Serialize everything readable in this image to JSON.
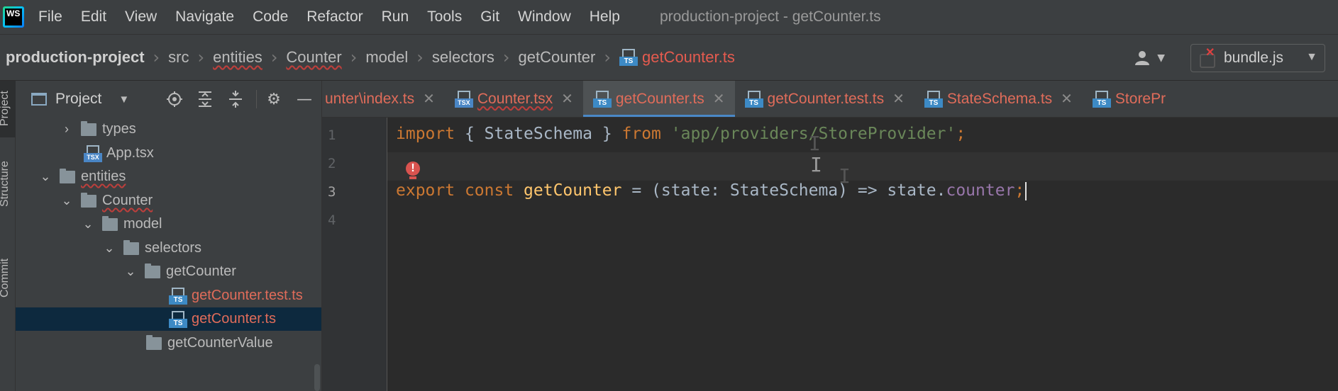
{
  "menubar": {
    "logo_text": "WS",
    "items": [
      "File",
      "Edit",
      "View",
      "Navigate",
      "Code",
      "Refactor",
      "Run",
      "Tools",
      "Git",
      "Window",
      "Help"
    ],
    "window_title": "production-project - getCounter.ts"
  },
  "breadcrumb": {
    "items": [
      "production-project",
      "src",
      "entities",
      "Counter",
      "model",
      "selectors",
      "getCounter",
      "getCounter.ts"
    ],
    "file_icon": "ts-file-icon"
  },
  "toolbar": {
    "user_icon": "user-icon",
    "run_config": "bundle.js"
  },
  "tool_stripe": {
    "items": [
      "Project",
      "Structure",
      "Commit"
    ]
  },
  "project_panel": {
    "title": "Project",
    "tools": [
      "locate-icon",
      "expand-all-icon",
      "collapse-all-icon",
      "gear-icon",
      "minimize-icon"
    ],
    "tree": [
      {
        "label": "types",
        "kind": "folder",
        "arrow": "›"
      },
      {
        "label": "App.tsx",
        "kind": "tsx",
        "arrow": ""
      },
      {
        "label": "entities",
        "kind": "folder",
        "arrow": "⌄"
      },
      {
        "label": "Counter",
        "kind": "folder",
        "arrow": "⌄"
      },
      {
        "label": "model",
        "kind": "folder",
        "arrow": "⌄"
      },
      {
        "label": "selectors",
        "kind": "folder",
        "arrow": "⌄"
      },
      {
        "label": "getCounter",
        "kind": "folder",
        "arrow": "⌄"
      },
      {
        "label": "getCounter.test.ts",
        "kind": "ts",
        "arrow": ""
      },
      {
        "label": "getCounter.ts",
        "kind": "ts",
        "arrow": ""
      },
      {
        "label": "getCounterValue",
        "kind": "folder",
        "arrow": ""
      }
    ]
  },
  "tabs": [
    {
      "label": "unter\\index.ts",
      "icon": ""
    },
    {
      "label": "Counter.tsx",
      "icon": "TSX"
    },
    {
      "label": "getCounter.ts",
      "icon": "TS"
    },
    {
      "label": "getCounter.test.ts",
      "icon": "TS"
    },
    {
      "label": "StateSchema.ts",
      "icon": "TS"
    },
    {
      "label": "StorePr",
      "icon": "TS"
    }
  ],
  "editor": {
    "line_numbers": [
      "1",
      "2",
      "3",
      "4"
    ],
    "line1": {
      "kw_import": "import",
      "brace_open": " { ",
      "ident": "StateSchema",
      "brace_close": " } ",
      "kw_from": "from",
      "space": " ",
      "path": "'app/providers/StoreProvider'",
      "semi": ";"
    },
    "line3": {
      "kw_export": "export",
      "kw_const": " const ",
      "fn_name": "getCounter",
      "rest1": " = (state: StateSchema) => state.",
      "prop": "counter",
      "semi": ";"
    },
    "intention_icon": "error-bulb-icon",
    "intention_glyph": "!"
  }
}
